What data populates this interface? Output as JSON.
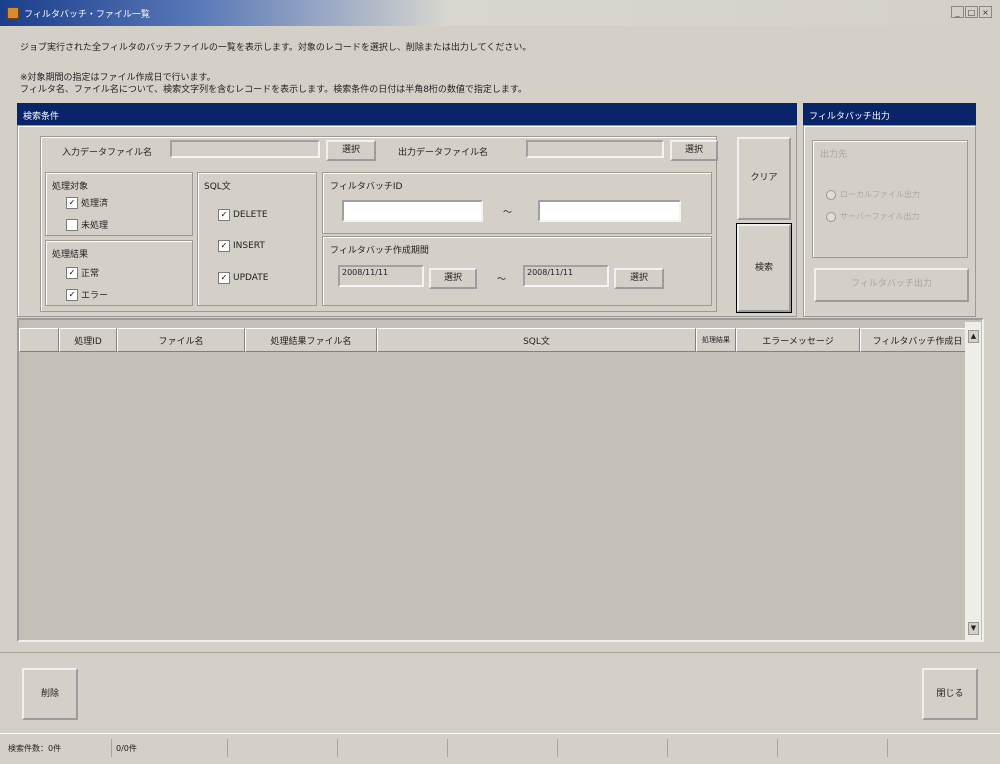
{
  "window": {
    "title": "フィルタバッチ・ファイル一覧",
    "buttons": [
      "_",
      "□",
      "×"
    ]
  },
  "description": {
    "line1": "ジョブ実行された全フィルタのバッチファイルの一覧を表示します。対象のレコードを選択し、削除または出力してください。",
    "line2": "※対象期間の指定はファイル作成日で行います。",
    "line3": "フィルタ名、ファイル名について、検索文字列を含むレコードを表示します。検索条件の日付は半角8桁の数値で指定します。"
  },
  "search": {
    "header": "検索条件",
    "file_name_label": "入力データファイル名",
    "file_name_value": "",
    "file_select_button": "選択",
    "output_file_label": "出力データファイル名",
    "output_file_value": "",
    "output_select_button": "選択",
    "target_label": "処理対象",
    "target_options": [
      {
        "label": "処理済",
        "checked": true
      },
      {
        "label": "未処理",
        "checked": false
      }
    ],
    "status_label": "処理結果",
    "status_options": [
      {
        "label": "正常",
        "checked": true
      },
      {
        "label": "エラー",
        "checked": true
      }
    ],
    "sql_label": "SQL文",
    "sql_options": [
      {
        "label": "DELETE",
        "checked": true
      },
      {
        "label": "INSERT",
        "checked": true
      },
      {
        "label": "UPDATE",
        "checked": true
      }
    ],
    "filter_id_label": "フィルタバッチID",
    "filter_id_from": "",
    "filter_id_to": "",
    "range_sep": "～",
    "date_label": "フィルタバッチ作成期間",
    "date_from": "2008/11/11",
    "date_to": "2008/11/11",
    "date_from_button": "選択",
    "date_to_button": "選択",
    "clear_button": "クリア",
    "search_button": "検索"
  },
  "output": {
    "header": "フィルタバッチ出力",
    "group_label": "出力先",
    "radios": [
      {
        "label": "ローカルファイル出力",
        "selected": true
      },
      {
        "label": "サーバーファイル出力",
        "selected": false
      }
    ],
    "output_button": "フィルタバッチ出力"
  },
  "grid": {
    "columns": [
      "",
      "処理ID",
      "ファイル名",
      "処理結果ファイル名",
      "SQL文",
      "処理結果",
      "エラーメッセージ",
      "フィルタバッチ作成日"
    ]
  },
  "footer": {
    "delete_button": "削除",
    "close_button": "閉じる"
  },
  "statusbar": {
    "cells": [
      "検索件数：0件",
      "0/0件",
      "",
      "",
      "",
      "",
      "",
      "",
      ""
    ]
  }
}
